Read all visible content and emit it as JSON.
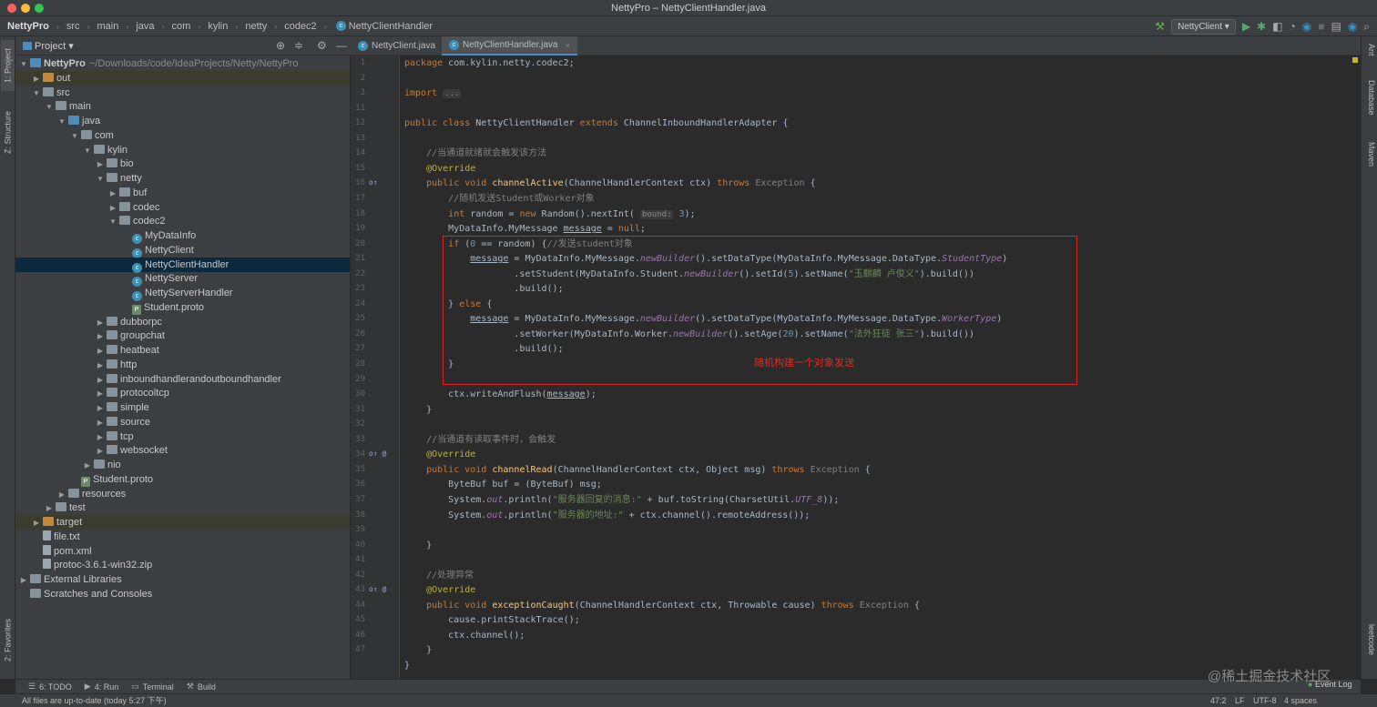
{
  "window": {
    "title": "NettyPro – NettyClientHandler.java"
  },
  "breadcrumbs": [
    "NettyPro",
    "src",
    "main",
    "java",
    "com",
    "kylin",
    "netty",
    "codec2",
    "NettyClientHandler"
  ],
  "run": {
    "config": "NettyClient"
  },
  "left_strip": {
    "project": "1: Project",
    "structure": "Z: Structure",
    "favorites": "2: Favorites"
  },
  "right_strip": {
    "ant": "Ant",
    "database": "Database",
    "maven": "Maven",
    "leetcode": "leetcode"
  },
  "project_panel": {
    "title": "Project"
  },
  "tree": [
    {
      "label": "NettyPro",
      "extra": "~/Downloads/code/IdeaProjects/Netty/NettyPro",
      "depth": 0,
      "arrow": "open",
      "icon": "folder-blue",
      "bold": true
    },
    {
      "label": "out",
      "depth": 1,
      "arrow": "closed",
      "icon": "folder-orange",
      "hl": true
    },
    {
      "label": "src",
      "depth": 1,
      "arrow": "open",
      "icon": "folder"
    },
    {
      "label": "main",
      "depth": 2,
      "arrow": "open",
      "icon": "folder"
    },
    {
      "label": "java",
      "depth": 3,
      "arrow": "open",
      "icon": "folder-blue"
    },
    {
      "label": "com",
      "depth": 4,
      "arrow": "open",
      "icon": "folder"
    },
    {
      "label": "kylin",
      "depth": 5,
      "arrow": "open",
      "icon": "folder"
    },
    {
      "label": "bio",
      "depth": 6,
      "arrow": "closed",
      "icon": "folder"
    },
    {
      "label": "netty",
      "depth": 6,
      "arrow": "open",
      "icon": "folder"
    },
    {
      "label": "buf",
      "depth": 7,
      "arrow": "closed",
      "icon": "folder"
    },
    {
      "label": "codec",
      "depth": 7,
      "arrow": "closed",
      "icon": "folder"
    },
    {
      "label": "codec2",
      "depth": 7,
      "arrow": "open",
      "icon": "folder"
    },
    {
      "label": "MyDataInfo",
      "depth": 8,
      "arrow": "",
      "icon": "class"
    },
    {
      "label": "NettyClient",
      "depth": 8,
      "arrow": "",
      "icon": "class"
    },
    {
      "label": "NettyClientHandler",
      "depth": 8,
      "arrow": "",
      "icon": "class",
      "sel": true
    },
    {
      "label": "NettyServer",
      "depth": 8,
      "arrow": "",
      "icon": "class"
    },
    {
      "label": "NettyServerHandler",
      "depth": 8,
      "arrow": "",
      "icon": "class"
    },
    {
      "label": "Student.proto",
      "depth": 8,
      "arrow": "",
      "icon": "proto"
    },
    {
      "label": "dubborpc",
      "depth": 6,
      "arrow": "closed",
      "icon": "folder"
    },
    {
      "label": "groupchat",
      "depth": 6,
      "arrow": "closed",
      "icon": "folder"
    },
    {
      "label": "heatbeat",
      "depth": 6,
      "arrow": "closed",
      "icon": "folder"
    },
    {
      "label": "http",
      "depth": 6,
      "arrow": "closed",
      "icon": "folder"
    },
    {
      "label": "inboundhandlerandoutboundhandler",
      "depth": 6,
      "arrow": "closed",
      "icon": "folder"
    },
    {
      "label": "protocoltcp",
      "depth": 6,
      "arrow": "closed",
      "icon": "folder"
    },
    {
      "label": "simple",
      "depth": 6,
      "arrow": "closed",
      "icon": "folder"
    },
    {
      "label": "source",
      "depth": 6,
      "arrow": "closed",
      "icon": "folder"
    },
    {
      "label": "tcp",
      "depth": 6,
      "arrow": "closed",
      "icon": "folder"
    },
    {
      "label": "websocket",
      "depth": 6,
      "arrow": "closed",
      "icon": "folder"
    },
    {
      "label": "nio",
      "depth": 5,
      "arrow": "closed",
      "icon": "folder"
    },
    {
      "label": "Student.proto",
      "depth": 4,
      "arrow": "",
      "icon": "proto"
    },
    {
      "label": "resources",
      "depth": 3,
      "arrow": "closed",
      "icon": "folder"
    },
    {
      "label": "test",
      "depth": 2,
      "arrow": "closed",
      "icon": "folder"
    },
    {
      "label": "target",
      "depth": 1,
      "arrow": "closed",
      "icon": "folder-orange",
      "hl": true
    },
    {
      "label": "file.txt",
      "depth": 1,
      "arrow": "",
      "icon": "file"
    },
    {
      "label": "pom.xml",
      "depth": 1,
      "arrow": "",
      "icon": "file"
    },
    {
      "label": "protoc-3.6.1-win32.zip",
      "depth": 1,
      "arrow": "",
      "icon": "file"
    },
    {
      "label": "External Libraries",
      "depth": 0,
      "arrow": "closed",
      "icon": "lib"
    },
    {
      "label": "Scratches and Consoles",
      "depth": 0,
      "arrow": "",
      "icon": "scratch"
    }
  ],
  "tabs": [
    {
      "label": "NettyClient.java",
      "active": false
    },
    {
      "label": "NettyClientHandler.java",
      "active": true
    }
  ],
  "line_numbers": [
    "1",
    "2",
    "3",
    "11",
    "12",
    "13",
    "14",
    "15",
    "16",
    "17",
    "18",
    "19",
    "20",
    "21",
    "22",
    "23",
    "24",
    "25",
    "26",
    "27",
    "28",
    "29",
    "30",
    "31",
    "32",
    "33",
    "34",
    "35",
    "36",
    "37",
    "38",
    "39",
    "40",
    "41",
    "42",
    "43",
    "44",
    "45",
    "46",
    "47"
  ],
  "code_lines": [
    [
      [
        "kw",
        "package "
      ],
      [
        "",
        "com.kylin.netty.codec2;"
      ]
    ],
    [],
    [
      [
        "kw",
        "import "
      ],
      [
        "hint",
        "..."
      ]
    ],
    [],
    [
      [
        "kw",
        "public class "
      ],
      [
        "",
        "NettyClientHandler "
      ],
      [
        "kw",
        "extends "
      ],
      [
        "",
        "ChannelInboundHandlerAdapter "
      ],
      [
        "",
        "{"
      ]
    ],
    [],
    [
      [
        "",
        "    "
      ],
      [
        "cm",
        "//当通道就绪就会触发该方法"
      ]
    ],
    [
      [
        "",
        "    "
      ],
      [
        "an",
        "@Override"
      ]
    ],
    [
      [
        "",
        "    "
      ],
      [
        "kw",
        "public void "
      ],
      [
        "fn",
        "channelActive"
      ],
      [
        "",
        "(ChannelHandlerContext ctx) "
      ],
      [
        "kw",
        "throws "
      ],
      [
        "ex",
        "Exception"
      ],
      [
        "",
        " {"
      ]
    ],
    [
      [
        "",
        "        "
      ],
      [
        "cm",
        "//随机发送Student或Worker对象"
      ]
    ],
    [
      [
        "",
        "        "
      ],
      [
        "kw",
        "int "
      ],
      [
        "",
        "random = "
      ],
      [
        "kw",
        "new "
      ],
      [
        "",
        "Random().nextInt( "
      ],
      [
        "hint",
        "bound:"
      ],
      [
        "nm",
        " 3"
      ],
      [
        "",
        ");"
      ]
    ],
    [
      [
        "",
        "        MyDataInfo.MyMessage "
      ],
      [
        "ul",
        "message"
      ],
      [
        "",
        " = "
      ],
      [
        "kw",
        "null"
      ],
      [
        "",
        ";"
      ]
    ],
    [
      [
        "",
        "        "
      ],
      [
        "kw",
        "if "
      ],
      [
        "",
        "("
      ],
      [
        "nm",
        "0"
      ],
      [
        "",
        " == random) {"
      ],
      [
        "cm",
        "//发送student对象"
      ]
    ],
    [
      [
        "",
        "            "
      ],
      [
        "ul",
        "message"
      ],
      [
        "",
        " = MyDataInfo.MyMessage."
      ],
      [
        "it",
        "newBuilder"
      ],
      [
        "",
        "().setDataType(MyDataInfo.MyMessage.DataType."
      ],
      [
        "it",
        "StudentType"
      ],
      [
        "",
        ")"
      ]
    ],
    [
      [
        "",
        "                    .setStudent(MyDataInfo.Student."
      ],
      [
        "it",
        "newBuilder"
      ],
      [
        "",
        "().setId("
      ],
      [
        "nm",
        "5"
      ],
      [
        "",
        ").setName("
      ],
      [
        "st",
        "\"玉麒麟 卢俊义\""
      ],
      [
        "",
        ").build())"
      ]
    ],
    [
      [
        "",
        "                    .build();"
      ]
    ],
    [
      [
        "",
        "        } "
      ],
      [
        "kw",
        "else "
      ],
      [
        "",
        "{"
      ]
    ],
    [
      [
        "",
        "            "
      ],
      [
        "ul",
        "message"
      ],
      [
        "",
        " = MyDataInfo.MyMessage."
      ],
      [
        "it",
        "newBuilder"
      ],
      [
        "",
        "().setDataType(MyDataInfo.MyMessage.DataType."
      ],
      [
        "it",
        "WorkerType"
      ],
      [
        "",
        ")"
      ]
    ],
    [
      [
        "",
        "                    .setWorker(MyDataInfo.Worker."
      ],
      [
        "it",
        "newBuilder"
      ],
      [
        "",
        "().setAge("
      ],
      [
        "nm",
        "20"
      ],
      [
        "",
        ").setName("
      ],
      [
        "st",
        "\"法外狂徒 张三\""
      ],
      [
        "",
        ").build())"
      ]
    ],
    [
      [
        "",
        "                    .build();"
      ]
    ],
    [
      [
        "",
        "        }"
      ]
    ],
    [],
    [
      [
        "",
        "        ctx.writeAndFlush("
      ],
      [
        "ul",
        "message"
      ],
      [
        "",
        ");"
      ]
    ],
    [
      [
        "",
        "    }"
      ]
    ],
    [],
    [
      [
        "",
        "    "
      ],
      [
        "cm",
        "//当通道有读取事件时，会触发"
      ]
    ],
    [
      [
        "",
        "    "
      ],
      [
        "an",
        "@Override"
      ]
    ],
    [
      [
        "",
        "    "
      ],
      [
        "kw",
        "public void "
      ],
      [
        "fn",
        "channelRead"
      ],
      [
        "",
        "(ChannelHandlerContext ctx, Object msg) "
      ],
      [
        "kw",
        "throws "
      ],
      [
        "ex",
        "Exception"
      ],
      [
        "",
        " {"
      ]
    ],
    [
      [
        "",
        "        ByteBuf buf = (ByteBuf) msg;"
      ]
    ],
    [
      [
        "",
        "        System."
      ],
      [
        "it",
        "out"
      ],
      [
        "",
        ".println("
      ],
      [
        "st",
        "\"服务器回复的消息:\""
      ],
      [
        "",
        " + buf.toString(CharsetUtil."
      ],
      [
        "it",
        "UTF_8"
      ],
      [
        "",
        "));"
      ]
    ],
    [
      [
        "",
        "        System."
      ],
      [
        "it",
        "out"
      ],
      [
        "",
        ".println("
      ],
      [
        "st",
        "\"服务器的地址:\""
      ],
      [
        "",
        " + ctx.channel().remoteAddress());"
      ]
    ],
    [],
    [
      [
        "",
        "    }"
      ]
    ],
    [],
    [
      [
        "",
        "    "
      ],
      [
        "cm",
        "//处理异常"
      ]
    ],
    [
      [
        "",
        "    "
      ],
      [
        "an",
        "@Override"
      ]
    ],
    [
      [
        "",
        "    "
      ],
      [
        "kw",
        "public void "
      ],
      [
        "fn",
        "exceptionCaught"
      ],
      [
        "",
        "(ChannelHandlerContext ctx, Throwable cause) "
      ],
      [
        "kw",
        "throws "
      ],
      [
        "ex",
        "Exception"
      ],
      [
        "",
        " {"
      ]
    ],
    [
      [
        "",
        "        cause.printStackTrace();"
      ]
    ],
    [
      [
        "",
        "        ctx.channel();"
      ]
    ],
    [
      [
        "",
        "    }"
      ]
    ],
    [
      [
        "",
        "}"
      ]
    ]
  ],
  "annotation": {
    "label": "随机构建一个对象发送",
    "color": "#d8261f"
  },
  "bottom_tabs": [
    "6: TODO",
    "4: Run",
    "Terminal",
    "Build"
  ],
  "status": {
    "message": "All files are up-to-date (today 5:27 下午)",
    "position": "47:2",
    "line_sep": "LF",
    "encoding": "UTF-8",
    "indent": "4 spaces",
    "event_log": "Event Log"
  },
  "watermark": "@稀土掘金技术社区",
  "colors": {
    "keyword": "#cc7832",
    "method": "#ffc66d",
    "annotation": "#bbb529",
    "comment": "#808080",
    "string": "#6a8759",
    "number": "#6897bb",
    "selection": "#0d293e"
  }
}
